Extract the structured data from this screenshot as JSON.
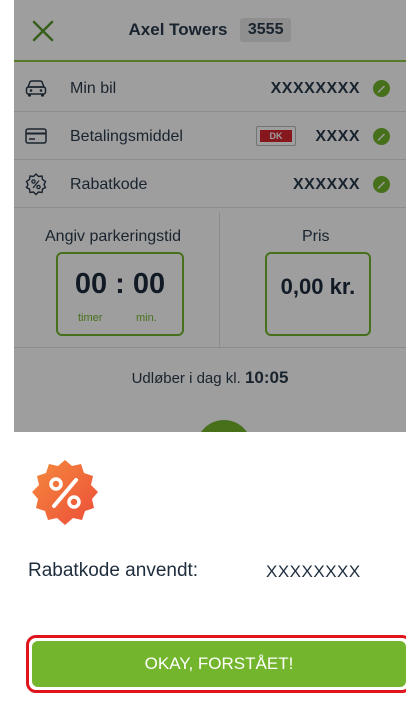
{
  "header": {
    "title": "Axel Towers",
    "zone": "3555"
  },
  "rows": [
    {
      "label": "Min bil",
      "value": "XXXXXXXX",
      "icon": "car-icon"
    },
    {
      "label": "Betalingsmiddel",
      "value": "XXXX",
      "card_brand": "DK",
      "icon": "credit-card-icon"
    },
    {
      "label": "Rabatkode",
      "value": "XXXXXX",
      "icon": "discount-icon"
    }
  ],
  "parking": {
    "time_label": "Angiv parkeringstid",
    "time_value": "00 : 00",
    "unit_hours": "timer",
    "unit_minutes": "min.",
    "price_label": "Pris",
    "price_value": "0,00 kr."
  },
  "expiry": {
    "text": "Udløber i dag kl.",
    "time": "10:05"
  },
  "sheet": {
    "applied_label": "Rabatkode anvendt:",
    "applied_value": "XXXXXXXX",
    "ok_label": "OKAY, FORSTÅET!"
  },
  "colors": {
    "accent": "#73b52d",
    "header_line": "#8cc63f",
    "badge": "#f26a3a",
    "highlight": "#e0141c"
  }
}
